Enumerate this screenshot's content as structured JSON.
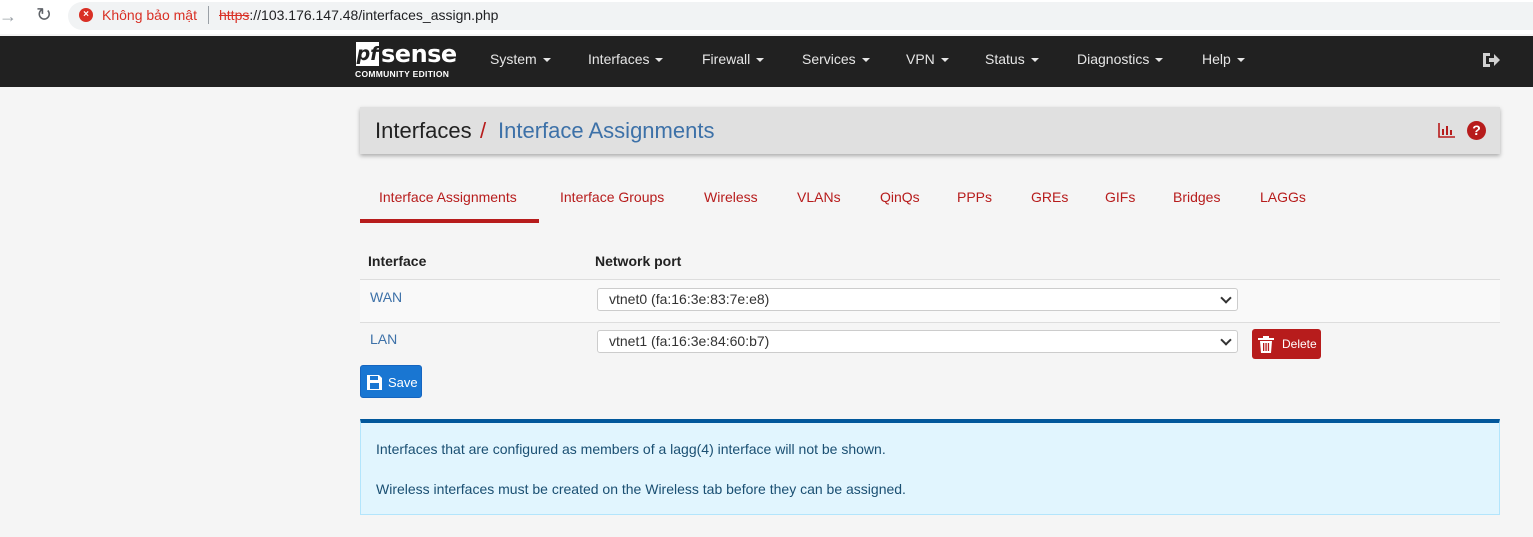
{
  "browser": {
    "security_label": "Không bảo mật",
    "url_scheme": "https",
    "url_rest": "://103.176.147.48/interfaces_assign.php"
  },
  "navbar": {
    "logo_pf": "pf",
    "logo_sense": "sense",
    "logo_edition": "COMMUNITY EDITION",
    "menu": [
      "System",
      "Interfaces",
      "Firewall",
      "Services",
      "VPN",
      "Status",
      "Diagnostics",
      "Help"
    ]
  },
  "breadcrumb": {
    "parent": "Interfaces",
    "separator": "/",
    "current": "Interface Assignments"
  },
  "tabs": [
    "Interface Assignments",
    "Interface Groups",
    "Wireless",
    "VLANs",
    "QinQs",
    "PPPs",
    "GREs",
    "GIFs",
    "Bridges",
    "LAGGs"
  ],
  "active_tab": "Interface Assignments",
  "table": {
    "headers": [
      "Interface",
      "Network port"
    ],
    "rows": [
      {
        "interface": "WAN",
        "port": "vtnet0 (fa:16:3e:83:7e:e8)"
      },
      {
        "interface": "LAN",
        "port": "vtnet1 (fa:16:3e:84:60:b7)",
        "delete_label": "Delete"
      }
    ]
  },
  "save_label": "Save",
  "info": [
    "Interfaces that are configured as members of a lagg(4) interface will not be shown.",
    "Wireless interfaces must be created on the Wireless tab before they can be assigned."
  ],
  "colors": {
    "navbar_bg": "#212121",
    "accent_red": "#b71c1c",
    "link_blue": "#3d71a8",
    "save_blue": "#1976d2",
    "info_bg": "#e1f5fe",
    "info_border": "#01579b"
  },
  "icons": [
    "back-arrow-icon",
    "reload-icon",
    "not-secure-icon",
    "caret-down-icon",
    "logout-icon",
    "chart-icon",
    "help-icon",
    "trash-icon",
    "save-icon"
  ]
}
